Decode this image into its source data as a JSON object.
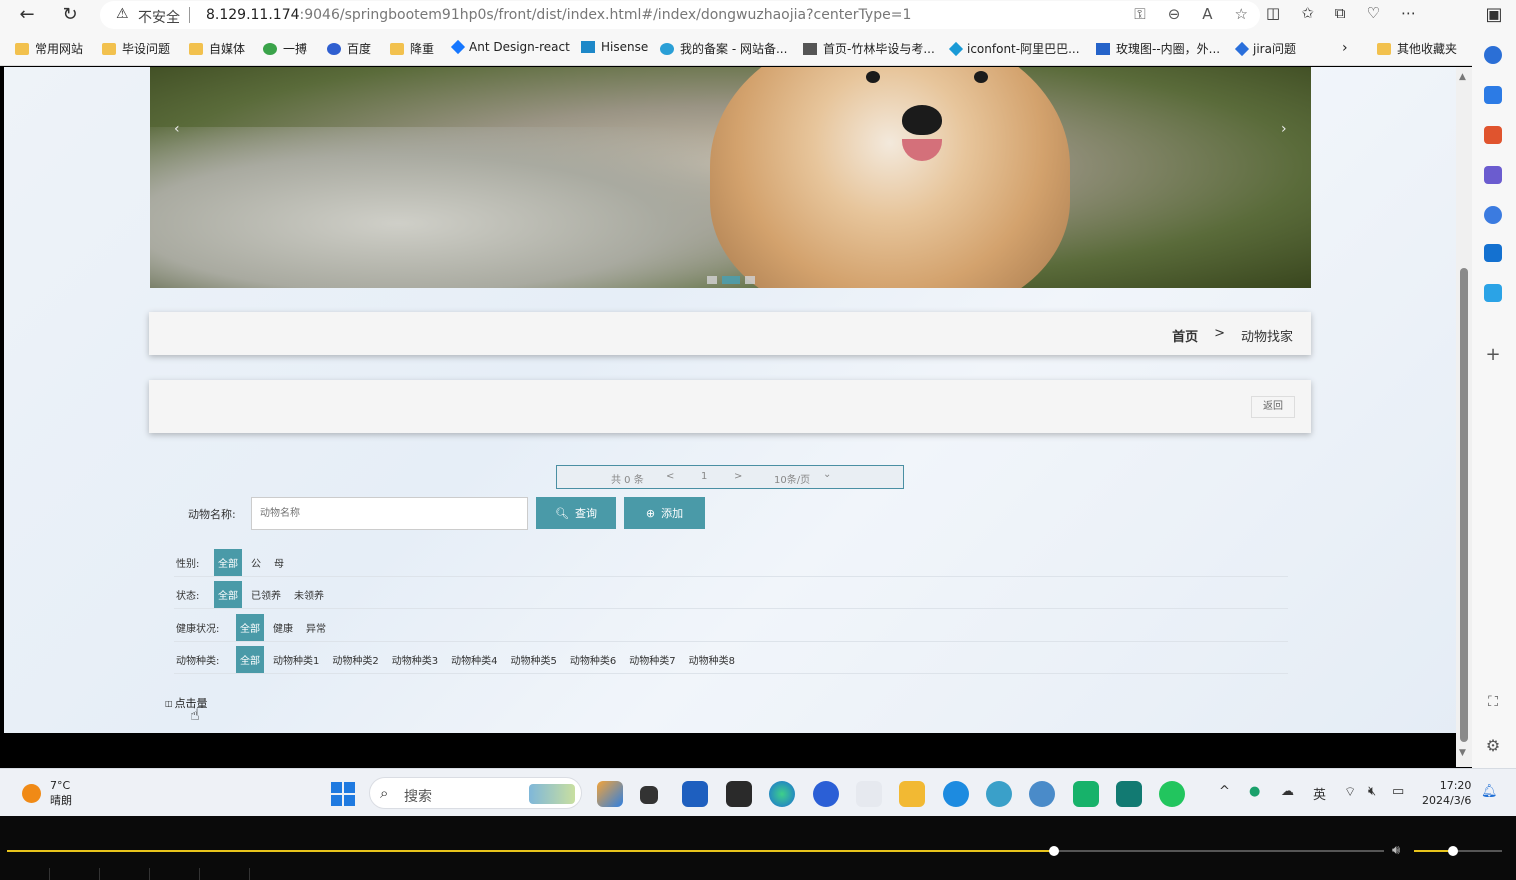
{
  "browser": {
    "security_label": "不安全",
    "url_host": "8.129.11.174",
    "url_rest": ":9046/springbootem91hp0s/front/dist/index.html#/index/dongwuzhaojia?centerType=1",
    "bookmarks": [
      {
        "label": "常用网站",
        "icon": "folder-icon"
      },
      {
        "label": "毕设问题",
        "icon": "folder-icon"
      },
      {
        "label": "自媒体",
        "icon": "folder-icon"
      },
      {
        "label": "一搏",
        "icon": "site-icon"
      },
      {
        "label": "百度",
        "icon": "baidu-icon"
      },
      {
        "label": "降重",
        "icon": "folder-icon"
      },
      {
        "label": "Ant Design-react",
        "icon": "antd-icon"
      },
      {
        "label": "Hisense",
        "icon": "hisense-icon"
      },
      {
        "label": "我的备案 - 网站备...",
        "icon": "cloud-icon"
      },
      {
        "label": "首页-竹林毕设与考...",
        "icon": "site-icon"
      },
      {
        "label": "iconfont-阿里巴巴...",
        "icon": "iconfont-icon"
      },
      {
        "label": "玫瑰图--内圈，外...",
        "icon": "chart-icon"
      },
      {
        "label": "jira问题",
        "icon": "jira-icon"
      },
      {
        "label": "其他收藏夹",
        "icon": "folder-icon"
      }
    ]
  },
  "page": {
    "breadcrumb": {
      "home": "首页",
      "separator": ">",
      "current": "动物找家"
    },
    "back_button": "返回",
    "pager": {
      "total": "共 0 条",
      "prev": "<",
      "page": "1",
      "next": ">",
      "size": "10条/页",
      "size_caret": "⌄"
    },
    "search": {
      "label": "动物名称:",
      "placeholder": "动物名称",
      "query_button": "查询",
      "add_button": "添加"
    },
    "filters": [
      {
        "label": "性别:",
        "options": [
          "全部",
          "公",
          "母"
        ],
        "selected": "全部"
      },
      {
        "label": "状态:",
        "options": [
          "全部",
          "已领养",
          "未领养"
        ],
        "selected": "全部"
      },
      {
        "label": "健康状况:",
        "options": [
          "全部",
          "健康",
          "异常"
        ],
        "selected": "全部"
      },
      {
        "label": "动物种类:",
        "options": [
          "全部",
          "动物种类1",
          "动物种类2",
          "动物种类3",
          "动物种类4",
          "动物种类5",
          "动物种类6",
          "动物种类7",
          "动物种类8"
        ],
        "selected": "全部"
      }
    ],
    "sort_label": "点击量",
    "carousel": {
      "slides": 3,
      "active_index": 1
    }
  },
  "taskbar": {
    "temperature": "7°C",
    "weather": "晴朗",
    "search_placeholder": "搜索",
    "ime": "英",
    "time": "17:20",
    "date": "2024/3/6"
  },
  "media": {
    "progress": 0.69,
    "volume": 0.45
  },
  "colors": {
    "accent": "#4a9aa8",
    "progress": "#e8c41c"
  }
}
